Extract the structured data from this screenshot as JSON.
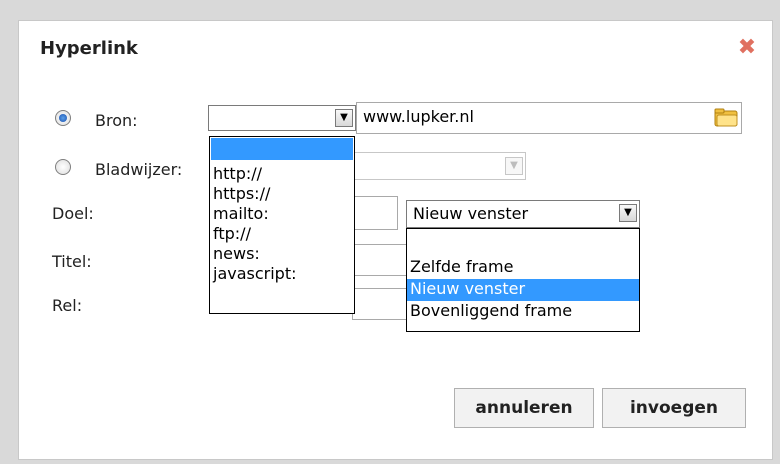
{
  "dialog": {
    "title": "Hyperlink",
    "close_icon": "close-icon"
  },
  "labels": {
    "bron": "Bron:",
    "bladwijzer": "Bladwijzer:",
    "doel": "Doel:",
    "titel": "Titel:",
    "rel": "Rel:"
  },
  "bron": {
    "protocol_value": "",
    "url_value": "www.lupker.nl",
    "protocol_options": [
      "",
      "http://",
      "https://",
      "mailto:",
      "ftp://",
      "news:",
      "javascript:"
    ]
  },
  "doel": {
    "selected": "Nieuw venster",
    "options": [
      "",
      "Zelfde frame",
      "Nieuw venster",
      "Bovenliggend frame"
    ]
  },
  "buttons": {
    "cancel": "annuleren",
    "insert": "invoegen"
  },
  "colors": {
    "highlight": "#3399ff",
    "close": "#e07060"
  }
}
